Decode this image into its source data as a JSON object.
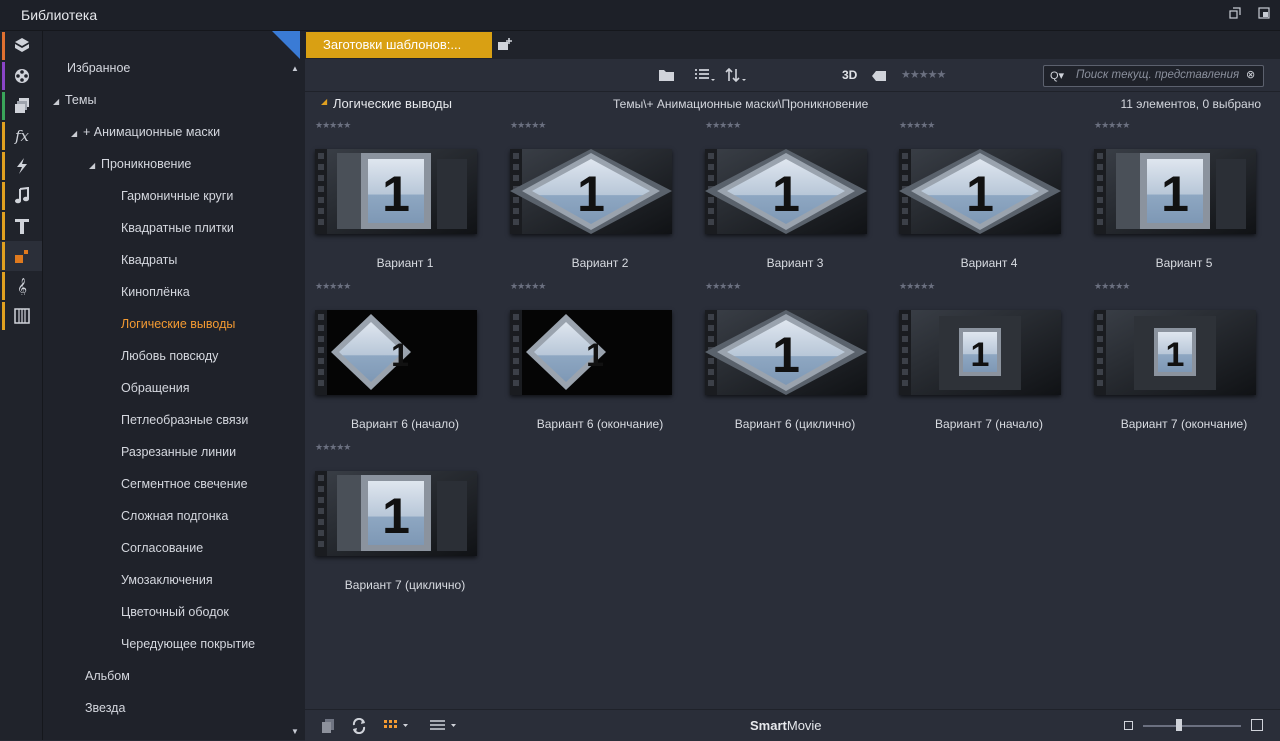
{
  "window": {
    "title": "Библиотека"
  },
  "rail": {
    "items": [
      {
        "icon": "box-icon",
        "color": "#e07030"
      },
      {
        "icon": "film-reel-icon",
        "color": "#8a45c8"
      },
      {
        "icon": "stacked-photos-icon",
        "color": "#3aa55a"
      },
      {
        "icon": "fx-icon",
        "color": "#e0a020"
      },
      {
        "icon": "lightning-icon",
        "color": "#e0a020"
      },
      {
        "icon": "music-note-icon",
        "color": "#e0a020"
      },
      {
        "icon": "title-t-icon",
        "color": "#e0a020"
      },
      {
        "icon": "montage-icon",
        "color": "#e0a020"
      },
      {
        "icon": "treble-clef-icon",
        "color": "#e0a020"
      },
      {
        "icon": "piano-icon",
        "color": "#e0a020"
      }
    ]
  },
  "tree": {
    "items": [
      {
        "label": "Избранное",
        "arrow": ""
      },
      {
        "label": "Темы",
        "arrow": "◢"
      },
      {
        "label": "+ Анимационные маски",
        "arrow": "◢"
      },
      {
        "label": "Проникновение",
        "arrow": "◢"
      },
      {
        "label": "Гармоничные круги",
        "arrow": ""
      },
      {
        "label": "Квадратные плитки",
        "arrow": ""
      },
      {
        "label": "Квадраты",
        "arrow": ""
      },
      {
        "label": "Киноплёнка",
        "arrow": ""
      },
      {
        "label": "Логические выводы",
        "arrow": ""
      },
      {
        "label": "Любовь повсюду",
        "arrow": ""
      },
      {
        "label": "Обращения",
        "arrow": ""
      },
      {
        "label": "Петлеобразные связи",
        "arrow": ""
      },
      {
        "label": "Разрезанные линии",
        "arrow": ""
      },
      {
        "label": "Сегментное свечение",
        "arrow": ""
      },
      {
        "label": "Сложная подгонка",
        "arrow": ""
      },
      {
        "label": "Согласование",
        "arrow": ""
      },
      {
        "label": "Умозаключения",
        "arrow": ""
      },
      {
        "label": "Цветочный ободок",
        "arrow": ""
      },
      {
        "label": "Чередующее покрытие",
        "arrow": ""
      },
      {
        "label": "Альбом",
        "arrow": ""
      },
      {
        "label": "Звезда",
        "arrow": ""
      }
    ],
    "selected": "Логические выводы"
  },
  "tabs": {
    "active_label": "Заготовки шаблонов:..."
  },
  "toolbar": {
    "three_d": "3D",
    "search_placeholder": "Поиск текущ. представления"
  },
  "pathbar": {
    "title": "Логические выводы",
    "path": "Темы\\+ Анимационные маски\\Проникновение",
    "count": "11 элементов, 0 выбрано"
  },
  "items": [
    {
      "label": "Вариант 1",
      "style": "square"
    },
    {
      "label": "Вариант 2",
      "style": "diamond"
    },
    {
      "label": "Вариант 3",
      "style": "diamond"
    },
    {
      "label": "Вариант 4",
      "style": "diamond"
    },
    {
      "label": "Вариант 5",
      "style": "square"
    },
    {
      "label": "Вариант 6 (начало)",
      "style": "diamond-small"
    },
    {
      "label": "Вариант 6 (окончание)",
      "style": "diamond-small"
    },
    {
      "label": "Вариант 6 (циклично)",
      "style": "diamond"
    },
    {
      "label": "Вариант 7 (начало)",
      "style": "square-small"
    },
    {
      "label": "Вариант 7 (окончание)",
      "style": "square-small"
    },
    {
      "label": "Вариант 7 (циклично)",
      "style": "square"
    }
  ],
  "thumbnail_digit": "1",
  "statusbar": {
    "brand_bold": "Smart",
    "brand_regular": "Movie"
  },
  "colors": {
    "accent": "#d9a013",
    "selected_text": "#f39a32"
  }
}
